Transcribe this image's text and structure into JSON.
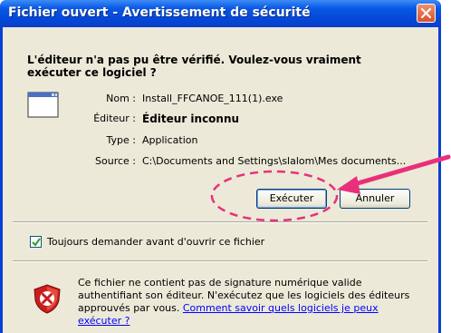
{
  "dialog": {
    "title": "Fichier ouvert - Avertissement de sécurité",
    "question": "L'éditeur n'a pas pu être vérifié. Voulez-vous vraiment exécuter ce logiciel ?",
    "fields": [
      {
        "label": "Nom :",
        "value": "Install_FFCANOE_111(1).exe"
      },
      {
        "label": "Éditeur :",
        "value": "Éditeur inconnu"
      },
      {
        "label": "Type :",
        "value": "Application"
      },
      {
        "label": "Source :",
        "value": "C:\\Documents and Settings\\slalom\\Mes documents..."
      }
    ],
    "buttons": {
      "run": "Exécuter",
      "cancel": "Annuler"
    },
    "checkbox": {
      "label": "Toujours demander avant d'ouvrir ce fichier",
      "checked": true
    },
    "warning": {
      "text": "Ce fichier ne contient pas de signature numérique valide authentifiant son éditeur. N'exécutez que les logiciels des éditeurs approuvés par vous.",
      "link": "Comment savoir quels logiciels je peux exécuter ?"
    }
  },
  "icons": [
    "close-icon",
    "application-icon",
    "checkbox-check-icon",
    "security-shield-icon",
    "annotation-arrow"
  ],
  "colors": {
    "titlebar": "#0a59e6",
    "client": "#ece9d8",
    "link": "#0000ff",
    "annotation": "#e8307a"
  }
}
